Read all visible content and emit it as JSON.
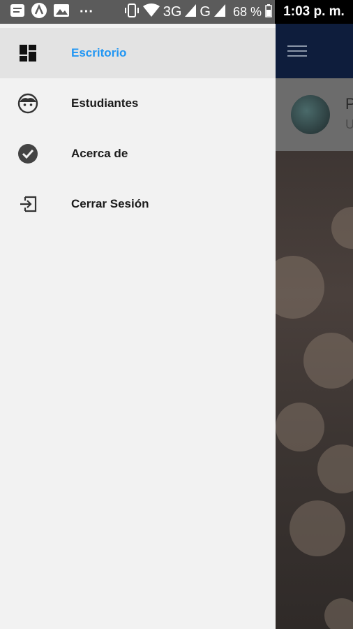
{
  "status_bar": {
    "signal_3g": "3G",
    "signal_g": "G",
    "battery": "68 %",
    "time": "1:03 p. m.",
    "dots": "···"
  },
  "drawer": {
    "items": [
      {
        "label": "Escritorio",
        "icon": "dashboard-icon",
        "active": true
      },
      {
        "label": "Estudiantes",
        "icon": "face-icon",
        "active": false
      },
      {
        "label": "Acerca de",
        "icon": "check-circle-icon",
        "active": false
      },
      {
        "label": "Cerrar Sesión",
        "icon": "exit-icon",
        "active": false
      }
    ]
  },
  "background_app": {
    "profile_name": "P",
    "profile_sub": "U"
  },
  "colors": {
    "active_label": "#2196f3",
    "appbar": "#0e1d3c",
    "drawer_bg": "#f2f2f2"
  }
}
